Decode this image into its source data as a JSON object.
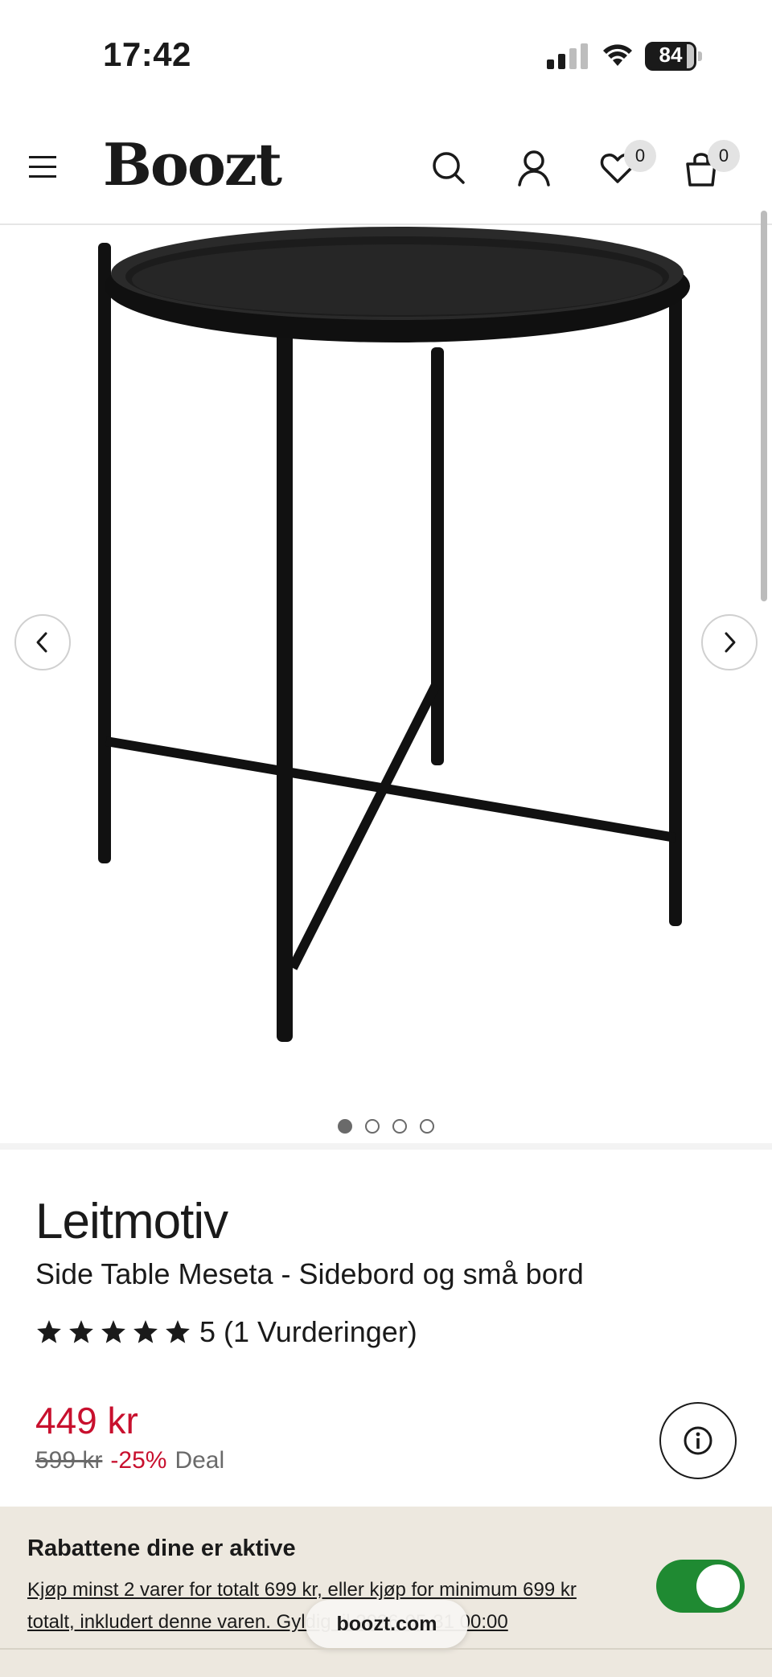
{
  "status_bar": {
    "time": "17:42",
    "battery": "84",
    "battery_level": 0.84
  },
  "header": {
    "logo": "Boozt",
    "wishlist_count": "0",
    "cart_count": "0",
    "icons": [
      "menu-icon",
      "search-icon",
      "user-icon",
      "heart-icon",
      "bag-icon"
    ]
  },
  "gallery": {
    "image_count": 4,
    "active_index": 0,
    "image_subject": "black round tray side table"
  },
  "product": {
    "brand": "Leitmotiv",
    "name": "Side Table Meseta - Sidebord og små bord",
    "rating_stars": 5,
    "rating_text": "5 (1 Vurderinger)",
    "price": "449 kr",
    "old_price": "599 kr",
    "discount": "-25%",
    "deal_label": "Deal"
  },
  "banner": {
    "title": "Rabattene dine er aktive",
    "text": "Kjøp minst 2 varer for totalt 699 kr, eller kjøp for minimum 699 kr totalt, inkludert denne varen. Gyldig til 2026-05-31 00:00",
    "toggle_on": true
  },
  "browser": {
    "url": "boozt.com"
  },
  "colors": {
    "price_red": "#c8102e",
    "toggle_green": "#1f8a32",
    "banner_bg": "#ede8df"
  }
}
